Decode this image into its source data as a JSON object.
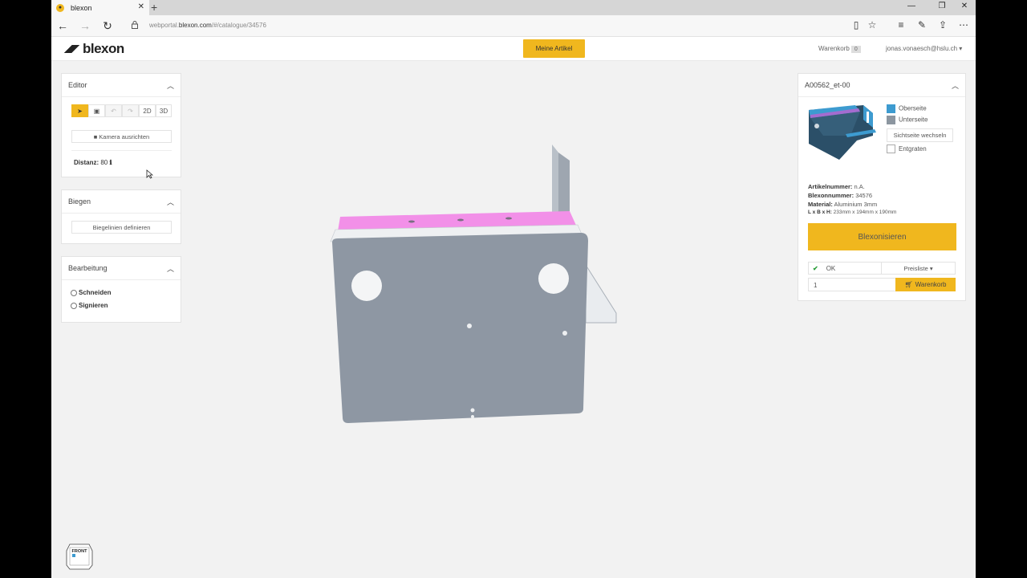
{
  "browser": {
    "tab_title": "blexon",
    "tab_close": "✕",
    "new_tab": "+",
    "url_prefix": "webportal.",
    "url_host": "blexon.com",
    "url_path": "/#/catalogue/34576",
    "win_min": "—",
    "win_max": "❐",
    "win_close": "✕"
  },
  "header": {
    "logo_text": "blexon",
    "my_articles": "Meine Artikel",
    "cart_label": "Warenkorb",
    "cart_count": "0",
    "user": "jonas.vonaesch@hslu.ch ▾"
  },
  "editor": {
    "title": "Editor",
    "mode_2d": "2D",
    "mode_3d": "3D",
    "camera_button": "Kamera ausrichten",
    "distance_label": "Distanz:",
    "distance_value": "80"
  },
  "biegen": {
    "title": "Biegen",
    "define_button": "Biegelinien definieren"
  },
  "bearbeitung": {
    "title": "Bearbeitung",
    "option_cut": "Schneiden",
    "option_sign": "Signieren"
  },
  "part": {
    "title": "A00562_et-00",
    "top_side": "Oberseite",
    "bottom_side": "Unterseite",
    "switch_side": "Sichtseite wechseln",
    "deburr": "Entgraten",
    "article_label": "Artikelnummer:",
    "article_value": "n.A.",
    "blexon_label": "Blexonnummer:",
    "blexon_value": "34576",
    "material_label": "Material:",
    "material_value": "Aluminium 3mm",
    "dims_label": "L x B x H:",
    "dims_value": "233mm x 194mm x 190mm",
    "blexonize": "Blexonisieren",
    "status": "OK",
    "pricelist": "Preisliste ▾",
    "quantity": "1",
    "cart_button": "Warenkorb"
  },
  "viewcube": {
    "label": "FRONT"
  },
  "colors": {
    "accent": "#f0b71e",
    "top_side": "#3d9bd0",
    "bottom_side": "#8c96a0",
    "model_face": "#8e97a3",
    "model_top": "#f290e8"
  }
}
